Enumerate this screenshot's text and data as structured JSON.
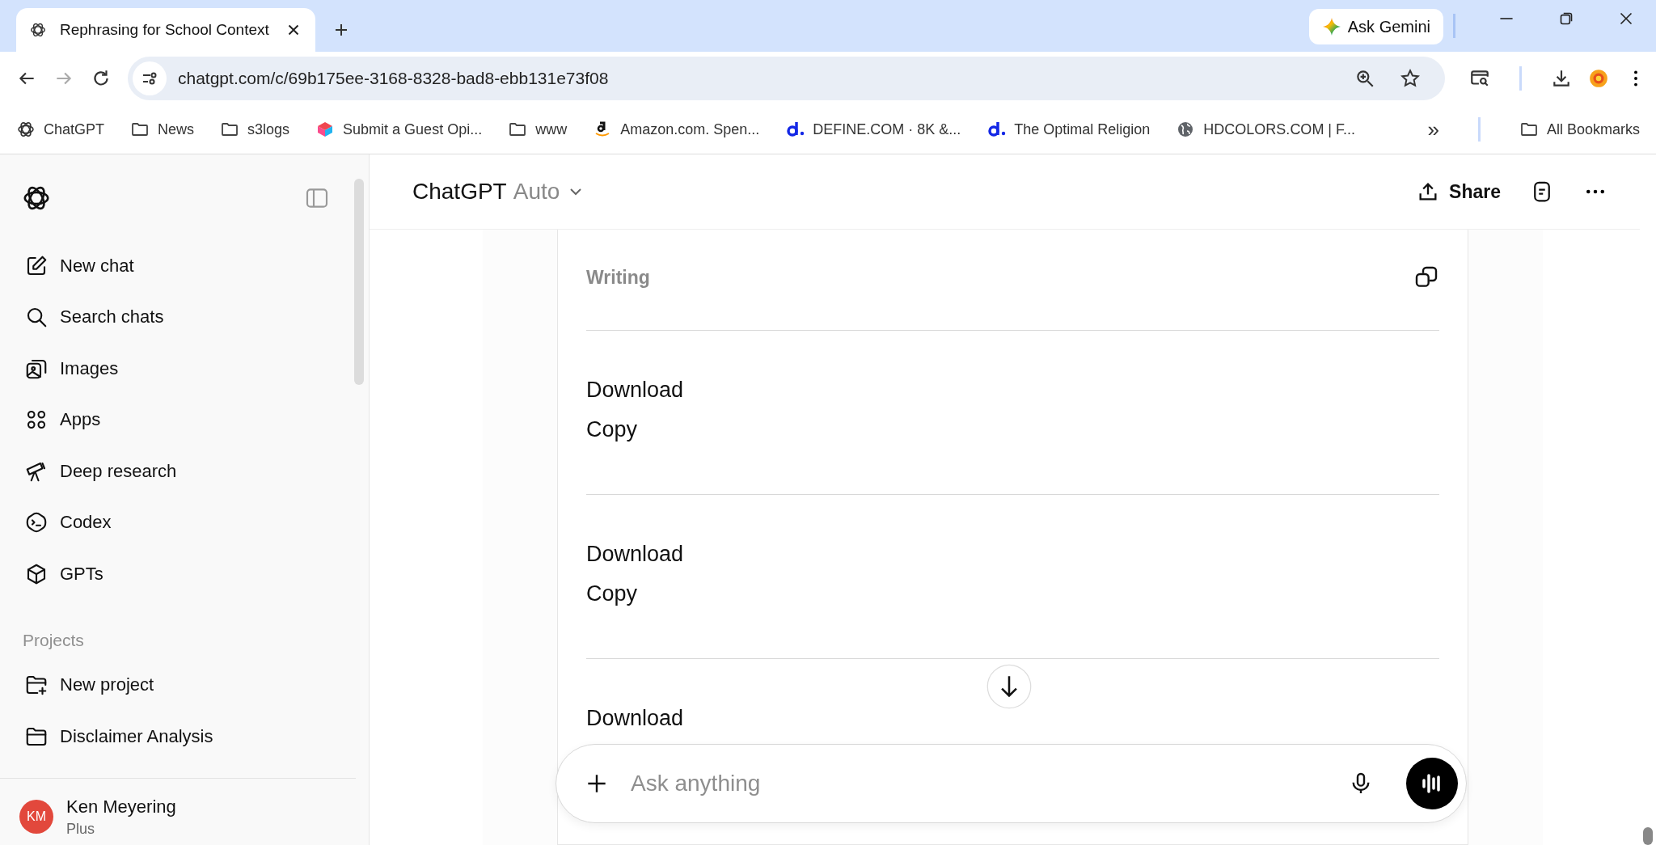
{
  "browser": {
    "tabs": [
      {
        "title": "Rephrasing for School Context",
        "selected": true
      }
    ],
    "ask_gemini": "Ask Gemini",
    "url": "chatgpt.com/c/69b175ee-3168-8328-bad8-ebb131e73f08",
    "bookmarks": [
      {
        "label": "ChatGPT",
        "kind": "chatgpt"
      },
      {
        "label": "News",
        "kind": "folder"
      },
      {
        "label": "s3logs",
        "kind": "folder"
      },
      {
        "label": "Submit a Guest Opi...",
        "kind": "cube"
      },
      {
        "label": "www",
        "kind": "folder"
      },
      {
        "label": "Amazon.com. Spen...",
        "kind": "amazon"
      },
      {
        "label": "DEFINE.COM · 8K &...",
        "kind": "define"
      },
      {
        "label": "The Optimal Religion",
        "kind": "define"
      },
      {
        "label": "HDCOLORS.COM | F...",
        "kind": "globe"
      }
    ],
    "overflow": "»",
    "all_bookmarks": "All Bookmarks"
  },
  "sidebar": {
    "nav": [
      {
        "label": "New chat",
        "kind": "edit"
      },
      {
        "label": "Search chats",
        "kind": "search"
      },
      {
        "label": "Images",
        "kind": "images"
      },
      {
        "label": "Apps",
        "kind": "apps"
      },
      {
        "label": "Deep research",
        "kind": "telescope"
      },
      {
        "label": "Codex",
        "kind": "codex"
      },
      {
        "label": "GPTs",
        "kind": "cube"
      }
    ],
    "projects_heading": "Projects",
    "projects": [
      {
        "label": "New project",
        "kind": "new-folder"
      },
      {
        "label": "Disclaimer Analysis",
        "kind": "folder"
      }
    ],
    "user": {
      "initials": "KM",
      "name": "Ken Meyering",
      "plan": "Plus"
    }
  },
  "header": {
    "title": "ChatGPT",
    "model": "Auto",
    "share": "Share"
  },
  "card": {
    "section_label": "Writing",
    "blocks": [
      {
        "lines": [
          "Download",
          "Copy"
        ]
      },
      {
        "lines": [
          "Download",
          "Copy"
        ]
      },
      {
        "lines": [
          "Download"
        ]
      }
    ]
  },
  "composer": {
    "placeholder": "Ask anything"
  }
}
